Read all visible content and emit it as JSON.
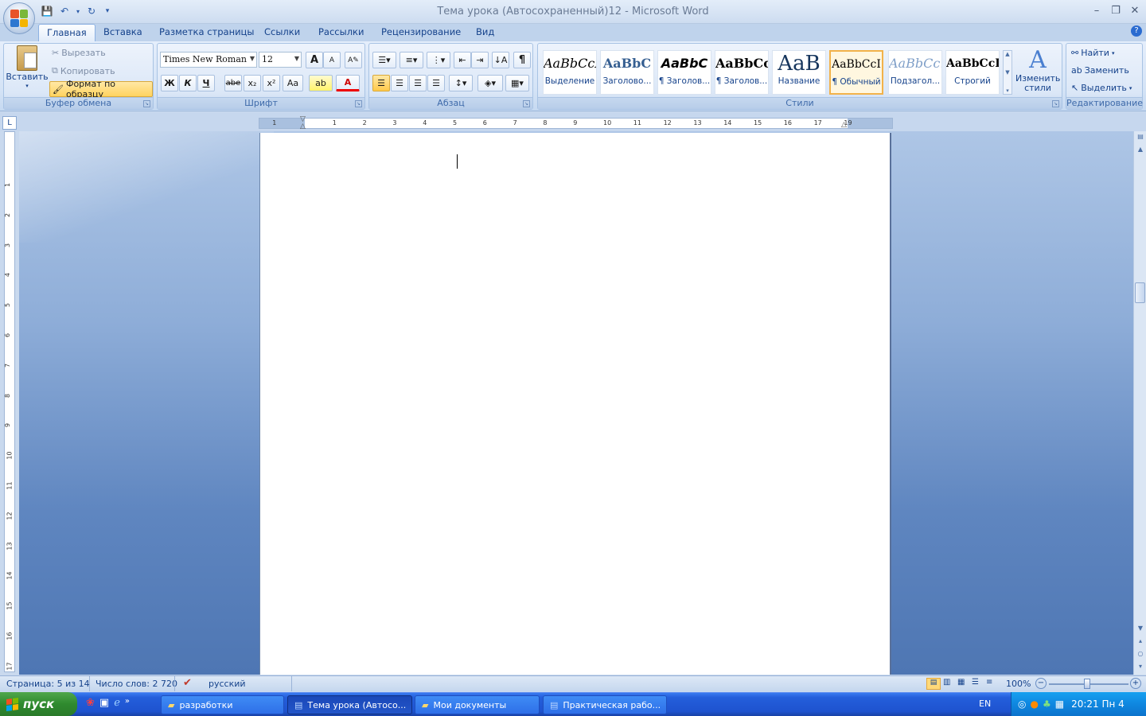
{
  "window": {
    "title": "Тема урока (Автосохраненный)12 - Microsoft Word",
    "minimize": "–",
    "restore": "❐",
    "close": "✕"
  },
  "qat": {
    "save_icon": "💾",
    "undo_icon": "↶",
    "redo_icon": "↻",
    "more": "▾"
  },
  "tabs": [
    "Главная",
    "Вставка",
    "Разметка страницы",
    "Ссылки",
    "Рассылки",
    "Рецензирование",
    "Вид"
  ],
  "clipboard": {
    "paste": "Вставить",
    "cut": "Вырезать",
    "copy": "Копировать",
    "format_painter": "Формат по образцу",
    "label": "Буфер обмена"
  },
  "font": {
    "name": "Times New Roman",
    "size": "12",
    "label": "Шрифт",
    "bold": "Ж",
    "italic": "К",
    "underline": "Ч",
    "strike": "abe",
    "sub": "x₂",
    "sup": "x²",
    "case": "Aa",
    "grow": "A",
    "shrink": "A",
    "color_letter": "A"
  },
  "paragraph": {
    "label": "Абзац",
    "pilcrow": "¶"
  },
  "styles": {
    "label": "Стили",
    "items": [
      {
        "sample": "AaBbCcI",
        "name": "Выделение"
      },
      {
        "sample": "AaBbC",
        "name": "Заголово..."
      },
      {
        "sample": "AaBbC",
        "name": "¶ Заголов..."
      },
      {
        "sample": "AaBbCc",
        "name": "¶ Заголов..."
      },
      {
        "sample": "AaB",
        "name": "Название"
      },
      {
        "sample": "AaBbCcI",
        "name": "¶ Обычный"
      },
      {
        "sample": "AaBbCc.",
        "name": "Подзагол..."
      },
      {
        "sample": "AaBbCcI",
        "name": "Строгий"
      }
    ],
    "change": "Изменить стили"
  },
  "editing": {
    "find": "Найти",
    "replace": "Заменить",
    "select": "Выделить",
    "label": "Редактирование"
  },
  "hruler_numbers": [
    "1",
    "1",
    "2",
    "3",
    "4",
    "5",
    "6",
    "7",
    "8",
    "9",
    "10",
    "11",
    "12",
    "13",
    "14",
    "15",
    "16",
    "17",
    "19"
  ],
  "vruler_numbers": [
    "1",
    "2",
    "3",
    "4",
    "5",
    "6",
    "7",
    "8",
    "9",
    "10",
    "11",
    "12",
    "13",
    "14",
    "15",
    "16",
    "17"
  ],
  "status": {
    "page": "Страница: 5 из 14",
    "words": "Число слов: 2 720",
    "lang": "русский",
    "zoom": "100%"
  },
  "taskbar": {
    "start": "пуск",
    "tasks": [
      "разработки",
      "Тема урока (Автосо...",
      "Мои документы",
      "Практическая рабо..."
    ],
    "lang": "EN",
    "clock": "20:21 Пн 4"
  },
  "colors": {
    "accent": "#15428b",
    "selected_style": "#f2b24a",
    "taskbar": "#245edb",
    "start": "#3c9a3b"
  }
}
